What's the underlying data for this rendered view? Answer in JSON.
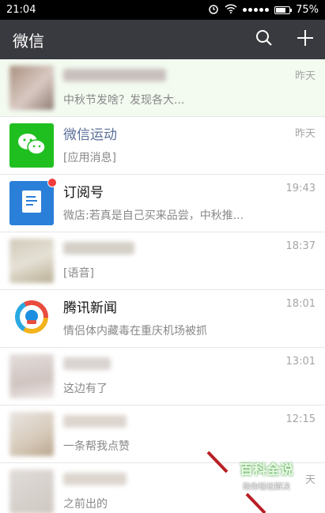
{
  "status": {
    "time": "21:04",
    "battery": "75%",
    "battery_level": 0.75
  },
  "header": {
    "title": "微信"
  },
  "chats": [
    {
      "name": "",
      "message": "中秋节发啥？发现各大...",
      "time": "昨天",
      "blurred": true,
      "pinned": true
    },
    {
      "name": "微信运动",
      "message": "[应用消息]",
      "time": "昨天",
      "blurred": false,
      "icon": "wechat-sport-icon"
    },
    {
      "name": "订阅号",
      "message": "微店:若真是自己买来品尝，中秋推...",
      "time": "19:43",
      "blurred": false,
      "icon": "subscription-icon",
      "unread_dot": true
    },
    {
      "name": "",
      "message": "[语音]",
      "time": "18:37",
      "blurred": true
    },
    {
      "name": "腾讯新闻",
      "message": "情侣体内藏毒在重庆机场被抓",
      "time": "18:01",
      "blurred": false,
      "icon": "tencent-news-icon"
    },
    {
      "name": "",
      "message": "这边有了",
      "time": "13:01",
      "blurred": true
    },
    {
      "name": "",
      "message": "一条帮我点赞",
      "time": "12:15",
      "blurred": true
    },
    {
      "name": "",
      "message": "之前出的",
      "time": "天",
      "blurred": true
    }
  ],
  "watermark": {
    "title": "百科全说",
    "subtitle": "助你轻松解决"
  },
  "colors": {
    "header_bg": "#393a3f",
    "accent_green": "#1aad19",
    "blue_name": "#5a6f99",
    "unread_red": "#f03c3c"
  }
}
